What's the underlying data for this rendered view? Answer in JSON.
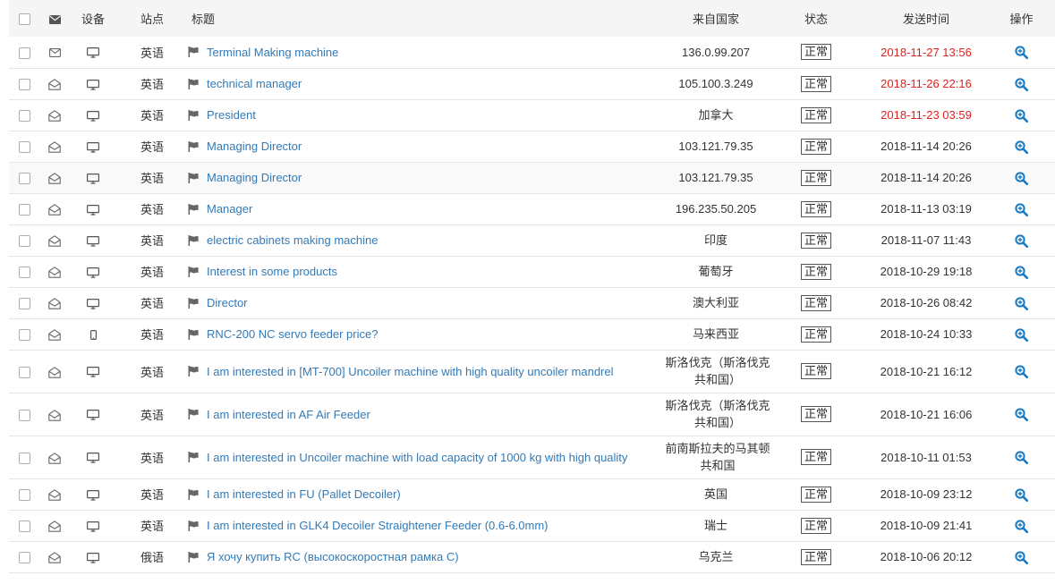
{
  "header": {
    "device": "设备",
    "site": "站点",
    "title": "标题",
    "country": "来自国家",
    "status": "状态",
    "time": "发送时间",
    "action": "操作"
  },
  "colors": {
    "link": "#337ab7",
    "recent": "#e02020"
  },
  "rows": [
    {
      "read": false,
      "device": "desktop-icon",
      "site": "英语",
      "title": "Terminal Making machine",
      "country": "136.0.99.207",
      "status": "正常",
      "time": "2018-11-27 13:56",
      "recent": true
    },
    {
      "read": true,
      "device": "desktop-icon",
      "site": "英语",
      "title": "technical manager",
      "country": "105.100.3.249",
      "status": "正常",
      "time": "2018-11-26 22:16",
      "recent": true
    },
    {
      "read": true,
      "device": "desktop-icon",
      "site": "英语",
      "title": "President",
      "country": "加拿大",
      "status": "正常",
      "time": "2018-11-23 03:59",
      "recent": true
    },
    {
      "read": true,
      "device": "desktop-icon",
      "site": "英语",
      "title": "Managing Director",
      "country": "103.121.79.35",
      "status": "正常",
      "time": "2018-11-14 20:26",
      "recent": false
    },
    {
      "read": true,
      "device": "desktop-icon",
      "site": "英语",
      "title": "Managing Director",
      "country": "103.121.79.35",
      "status": "正常",
      "time": "2018-11-14 20:26",
      "recent": false
    },
    {
      "read": true,
      "device": "desktop-icon",
      "site": "英语",
      "title": "Manager",
      "country": "196.235.50.205",
      "status": "正常",
      "time": "2018-11-13 03:19",
      "recent": false
    },
    {
      "read": true,
      "device": "desktop-icon",
      "site": "英语",
      "title": "electric cabinets making machine",
      "country": "印度",
      "status": "正常",
      "time": "2018-11-07 11:43",
      "recent": false
    },
    {
      "read": true,
      "device": "desktop-icon",
      "site": "英语",
      "title": "Interest in some products",
      "country": "葡萄牙",
      "status": "正常",
      "time": "2018-10-29 19:18",
      "recent": false
    },
    {
      "read": true,
      "device": "desktop-icon",
      "site": "英语",
      "title": "Director",
      "country": "澳大利亚",
      "status": "正常",
      "time": "2018-10-26 08:42",
      "recent": false
    },
    {
      "read": true,
      "device": "mobile-icon",
      "site": "英语",
      "title": "RNC-200 NC servo feeder price?",
      "country": "马来西亚",
      "status": "正常",
      "time": "2018-10-24 10:33",
      "recent": false
    },
    {
      "read": true,
      "device": "desktop-icon",
      "site": "英语",
      "title": "I am interested in [MT-700] Uncoiler machine with high quality uncoiler mandrel",
      "country": "斯洛伐克（斯洛伐克共和国）",
      "status": "正常",
      "time": "2018-10-21 16:12",
      "recent": false,
      "tall": true
    },
    {
      "read": true,
      "device": "desktop-icon",
      "site": "英语",
      "title": "I am interested in AF Air Feeder",
      "country": "斯洛伐克（斯洛伐克共和国）",
      "status": "正常",
      "time": "2018-10-21 16:06",
      "recent": false,
      "tall": true
    },
    {
      "read": true,
      "device": "desktop-icon",
      "site": "英语",
      "title": "I am interested in  Uncoiler machine with load capacity of 1000 kg with high quality",
      "country": "前南斯拉夫的马其顿共和国",
      "status": "正常",
      "time": "2018-10-11 01:53",
      "recent": false,
      "tall": true
    },
    {
      "read": true,
      "device": "desktop-icon",
      "site": "英语",
      "title": "I am interested in FU (Pallet Decoiler)",
      "country": "英国",
      "status": "正常",
      "time": "2018-10-09 23:12",
      "recent": false
    },
    {
      "read": true,
      "device": "desktop-icon",
      "site": "英语",
      "title": "I am interested in GLK4 Decoiler Straightener Feeder (0.6-6.0mm)",
      "country": "瑞士",
      "status": "正常",
      "time": "2018-10-09 21:41",
      "recent": false
    },
    {
      "read": true,
      "device": "desktop-icon",
      "site": "俄语",
      "title": "Я хочу купить RC (высокоскоростная рамка C)",
      "country": "乌克兰",
      "status": "正常",
      "time": "2018-10-06 20:12",
      "recent": false
    }
  ]
}
